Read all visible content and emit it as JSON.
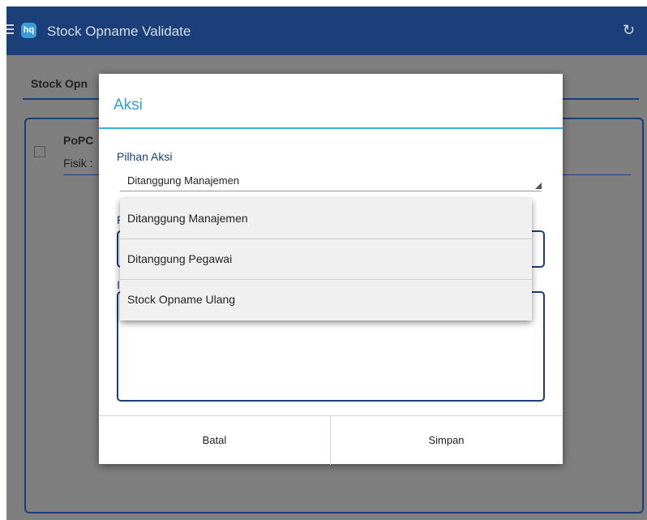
{
  "appbar": {
    "title": "Stock Opname Validate",
    "logo": "hq",
    "menu_icon": "menu-icon",
    "refresh_icon": "refresh-icon"
  },
  "content": {
    "tab_label": "Stock Opn",
    "card_name": "PoPC",
    "card_fisik": "Fisik :"
  },
  "dialog": {
    "title": "Aksi",
    "pilihan_label": "Pilhan Aksi",
    "selected_value": "Ditanggung Manajemen",
    "field1_label_fragment": "F",
    "field2_label_fragment": "I",
    "cancel_label": "Batal",
    "save_label": "Simpan"
  },
  "dropdown": {
    "options": [
      "Ditanggung Manajemen",
      "Ditanggung Pegawai",
      "Stock Opname Ulang"
    ]
  },
  "colors": {
    "appbar": "#1b3f78",
    "accent": "#3ab0e6",
    "overlay": "#7f7f7f"
  }
}
